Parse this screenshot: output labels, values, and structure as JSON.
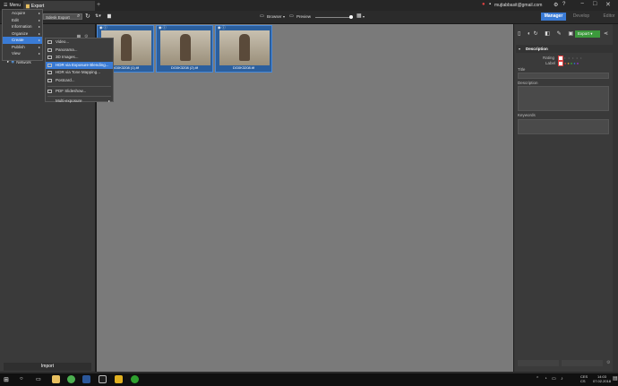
{
  "titlebar": {
    "menu_label": "Menu",
    "tab_label": "Export",
    "add_tab": "+",
    "email": "mujtabbasit@gmail.com",
    "minimize": "−",
    "maximize": "□",
    "close": "✕"
  },
  "toolbar": {
    "search_value": "Sdesk Export",
    "browser_label": "Browser",
    "preview_label": "Preview",
    "modes": [
      "Manager",
      "Develop",
      "Editor"
    ]
  },
  "left_panel": {
    "network_label": "Network",
    "import_label": "Import"
  },
  "main_menu": {
    "items": [
      {
        "label": "Acquire",
        "has_sub": true
      },
      {
        "label": "Edit",
        "has_sub": true
      },
      {
        "label": "Information",
        "has_sub": true
      },
      {
        "label": "Organize",
        "has_sub": true
      },
      {
        "label": "Create",
        "has_sub": true,
        "highlighted": true
      },
      {
        "label": "Publish",
        "has_sub": true
      },
      {
        "label": "View",
        "has_sub": true
      }
    ]
  },
  "create_menu": {
    "items": [
      {
        "label": "Video..."
      },
      {
        "label": "Panorama..."
      },
      {
        "label": "3D Images..."
      },
      {
        "label": "HDR via Exposure Blending...",
        "highlighted": true
      },
      {
        "label": "HDR via Tone Mapping..."
      },
      {
        "label": "Postcard..."
      },
      {
        "label": "PDF Slideshow..."
      },
      {
        "label": "Multi-exposure",
        "has_sub": true
      }
    ]
  },
  "thumbnails": [
    {
      "caption": "DG0K3208 (1).tif"
    },
    {
      "caption": "DG0K3208 (2).tif"
    },
    {
      "caption": "DG0K3208.tif"
    }
  ],
  "right_panel": {
    "export_label": "Export",
    "description_header": "Description",
    "rating_label": "Rating",
    "label_label": "Label",
    "title_label": "Title",
    "description_label": "Description",
    "keywords_label": "Keywords"
  },
  "taskbar": {
    "language": "CES CS",
    "time": "14:03",
    "date": "07.02.2018"
  },
  "colors": {
    "accent": "#3a7bd5",
    "export_green": "#3c9a3c",
    "content_bg": "#7a7a7a"
  }
}
